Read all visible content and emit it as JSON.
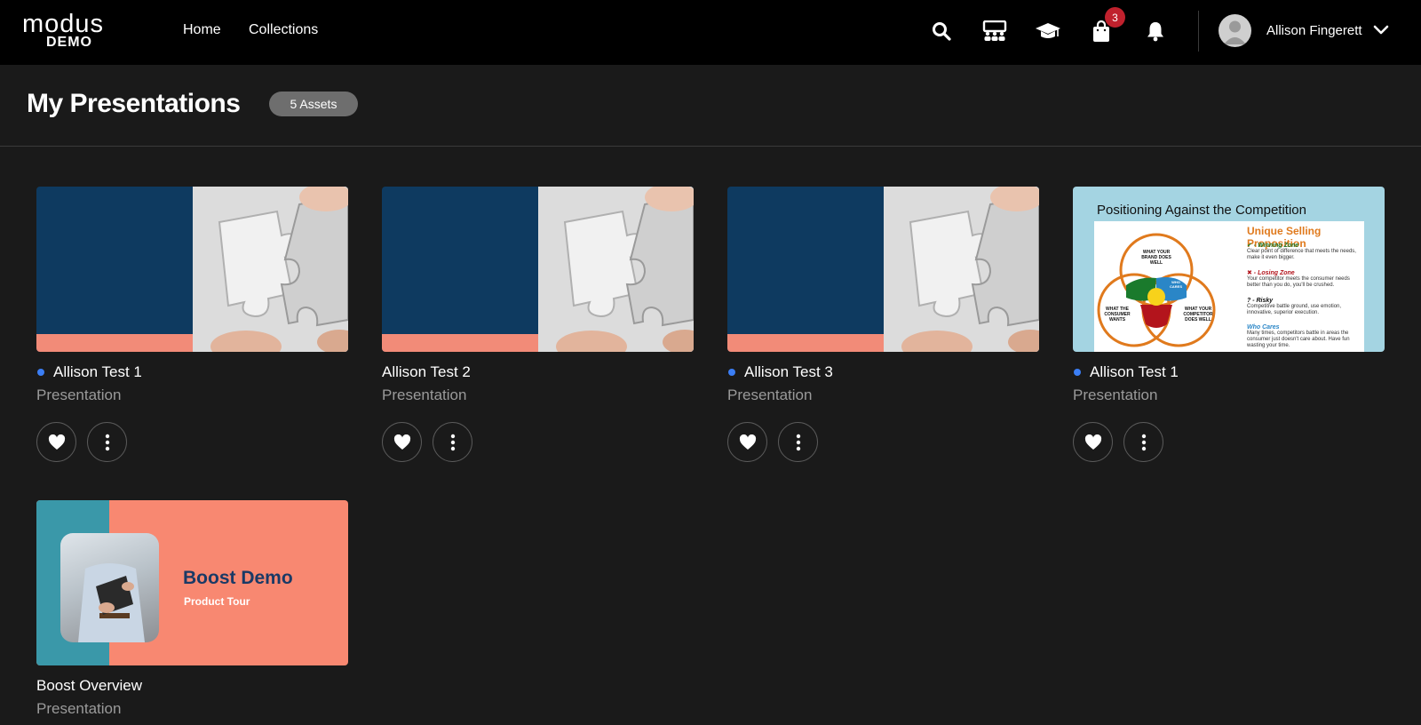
{
  "header": {
    "logo_word": "modus",
    "logo_sub": "DEMO",
    "nav": [
      {
        "label": "Home"
      },
      {
        "label": "Collections"
      }
    ],
    "icons": [
      "search-icon",
      "presentation-icon",
      "graduation-cap-icon",
      "shopping-bag-icon",
      "bell-icon"
    ],
    "cart_count": "3",
    "user_name": "Allison Fingerett"
  },
  "page": {
    "title": "My Presentations",
    "asset_count": "5 Assets"
  },
  "cards": [
    {
      "title": "Allison Test 1",
      "type": "Presentation",
      "dot": true
    },
    {
      "title": "Allison Test 2",
      "type": "Presentation",
      "dot": false
    },
    {
      "title": "Allison Test 3",
      "type": "Presentation",
      "dot": true
    },
    {
      "title": "Allison Test 1",
      "type": "Presentation",
      "dot": true
    },
    {
      "title": "Boost Overview",
      "type": "Presentation",
      "dot": false
    }
  ],
  "thumbs": {
    "competition": {
      "title": "Positioning Against the Competition",
      "usp": "Unique Selling Proposition",
      "zones": [
        {
          "label": "✔ - Winning Zone",
          "text": "Clear point of difference that meets the needs, make it even bigger."
        },
        {
          "label": "✖ - Losing Zone",
          "text": "Your competitor meets the consumer needs better than you do, you'll be crushed."
        },
        {
          "label": "? - Risky",
          "text": "Competitive battle ground, use emotion, innovative, superior execution."
        },
        {
          "label": "Who Cares",
          "text": "Many times, competitors battle in areas the consumer just doesn't care about. Have fun wasting your time."
        }
      ],
      "venn": {
        "brand": "WHAT YOUR BRAND DOES WELL",
        "consumer": "WHAT THE CONSUMER WANTS",
        "competitor": "WHAT YOUR COMPETITOR DOES WELL",
        "who_cares": "WHO CARES"
      }
    },
    "boost": {
      "title": "Boost Demo",
      "subtitle": "Product Tour"
    }
  },
  "colors": {
    "accent_dot": "#3b7ef5",
    "badge_red": "#c0212d",
    "navy": "#0e3a60",
    "salmon": "#f28b78"
  }
}
